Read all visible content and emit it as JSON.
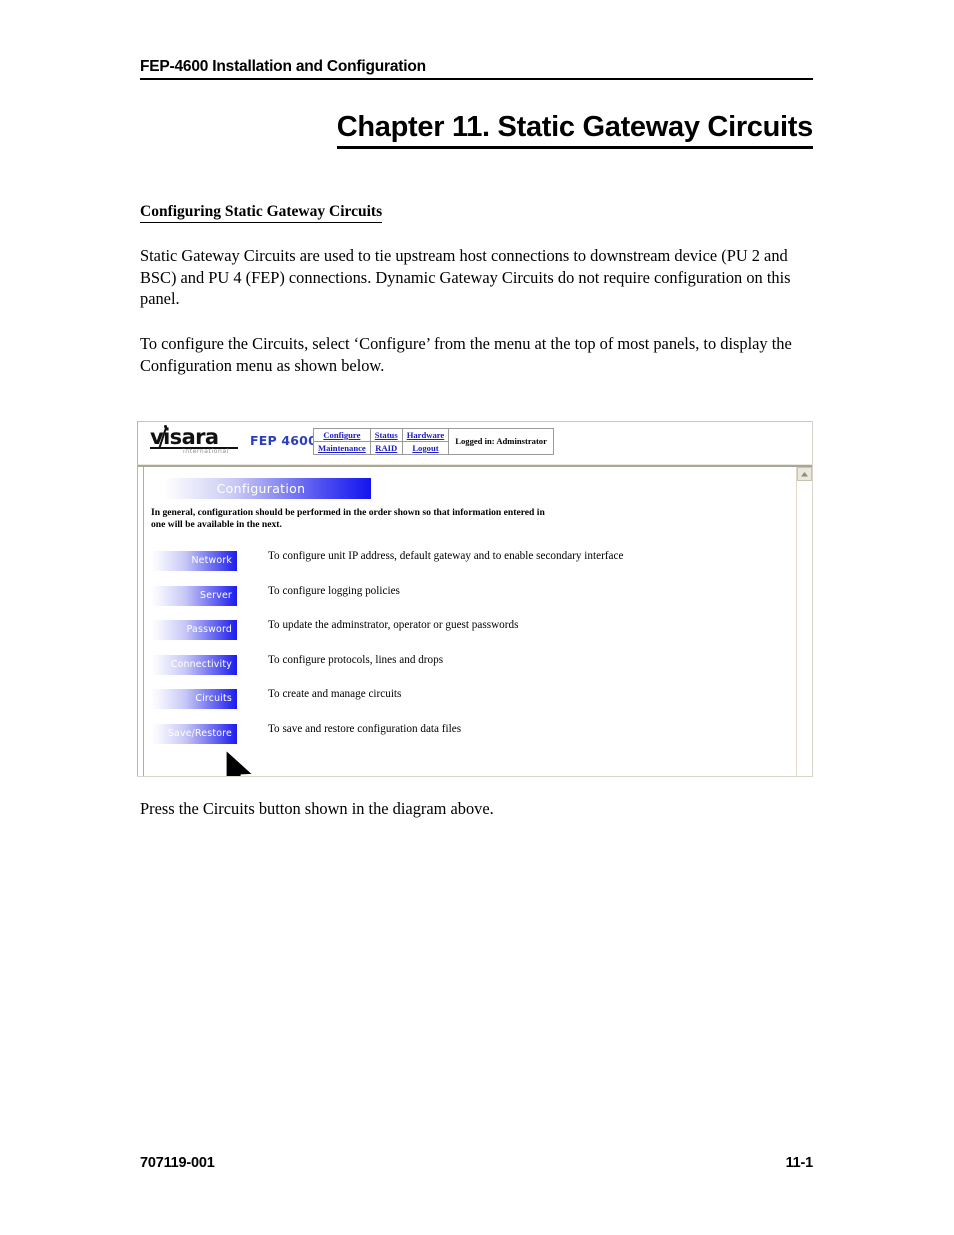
{
  "header": {
    "running_title": "FEP-4600 Installation and Configuration"
  },
  "chapter": {
    "title": "Chapter 11. Static Gateway Circuits"
  },
  "section": {
    "heading": "Configuring Static Gateway Circuits",
    "paragraph_intro": "Static Gateway Circuits are used to tie upstream host connections to downstream device (PU 2 and BSC) and PU 4 (FEP) connections. Dynamic Gateway Circuits do not require configuration on this panel.",
    "paragraph_configure": "To configure the Circuits, select ‘Configure’ from the menu at the top of most panels, to display the Configuration menu as shown below.",
    "paragraph_press": "Press the Circuits button shown in the diagram above."
  },
  "screenshot": {
    "brand": {
      "name": "visara",
      "tagline": "international",
      "model": "FEP 4600",
      "model_color": "#2b3fbe"
    },
    "nav": {
      "row1": [
        "Configure",
        "Status",
        "Hardware"
      ],
      "row2": [
        "Maintenance",
        "RAID",
        "Logout"
      ],
      "logged_in": "Logged in: Adminstrator",
      "link_color": "#1b1bc4"
    },
    "banner": {
      "title": "Configuration",
      "gradient_from": "#ffffff",
      "gradient_to": "#1414ef"
    },
    "note": "In general, configuration should be performed in the order shown so that information entered in one will be available in the next.",
    "buttons": [
      {
        "label": "Network",
        "description": "To configure unit IP address, default gateway and to enable secondary interface"
      },
      {
        "label": "Server",
        "description": "To configure logging policies"
      },
      {
        "label": "Password",
        "description": "To update the adminstrator, operator or guest passwords"
      },
      {
        "label": "Connectivity",
        "description": "To configure protocols, lines and drops"
      },
      {
        "label": "Circuits",
        "description": "To create and manage circuits"
      },
      {
        "label": "Save/Restore",
        "description": "To save and restore configuration data files"
      }
    ],
    "cursor": {
      "icon": "mouse-pointer-arrow",
      "points_at": "Circuits"
    },
    "scrollbar": {
      "up_arrow_icon": "chevron-up-icon"
    }
  },
  "footer": {
    "document_number": "707119-001",
    "page_number": "11-1"
  }
}
